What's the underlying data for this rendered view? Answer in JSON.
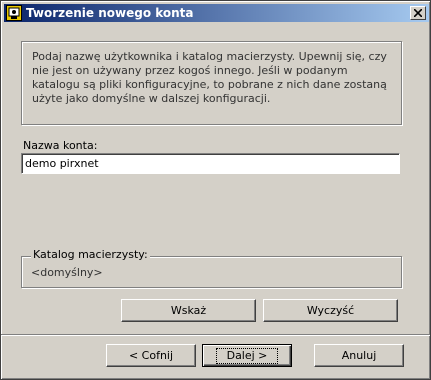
{
  "window": {
    "title": "Tworzenie nowego konta",
    "icon": "app-icon",
    "close_label": "close"
  },
  "info": {
    "text": "Podaj nazwę użytkownika i katalog macierzysty. Upewnij się, czy nie jest on używany przez kogoś innego. Jeśli w podanym katalogu są pliki konfiguracyjne, to pobrane z nich dane zostaną użyte jako domyślne w dalszej konfiguracji."
  },
  "account": {
    "label": "Nazwa konta:",
    "value": "demo pirxnet"
  },
  "home_dir": {
    "label": "Katalog macierzysty:",
    "value": "<domyślny>"
  },
  "buttons": {
    "browse": "Wskaż",
    "clear": "Wyczyść",
    "back": "< Cofnij",
    "next": "Dalej >",
    "cancel": "Anuluj"
  }
}
